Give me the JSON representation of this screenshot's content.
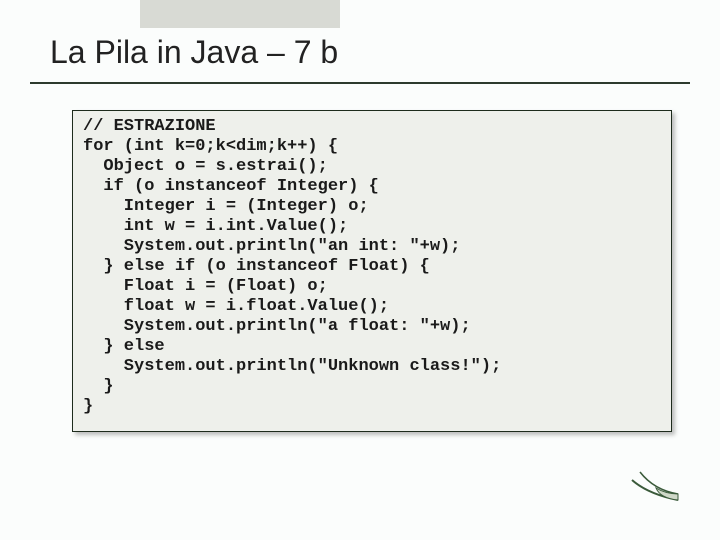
{
  "title": "La Pila in Java – 7 b",
  "code": {
    "l01": "// ESTRAZIONE",
    "l02": "for (int k=0;k<dim;k++) {",
    "l03": "  Object o = s.estrai();",
    "l04": "  if (o instanceof Integer) {",
    "l05": "    Integer i = (Integer) o;",
    "l06": "    int w = i.int.Value();",
    "l07": "    System.out.println(\"an int: \"+w);",
    "l08": "  } else if (o instanceof Float) {",
    "l09": "    Float i = (Float) o;",
    "l10": "    float w = i.float.Value();",
    "l11": "    System.out.println(\"a float: \"+w);",
    "l12": "  } else",
    "l13": "    System.out.println(\"Unknown class!\");",
    "l14": "  }",
    "l15": "}"
  }
}
